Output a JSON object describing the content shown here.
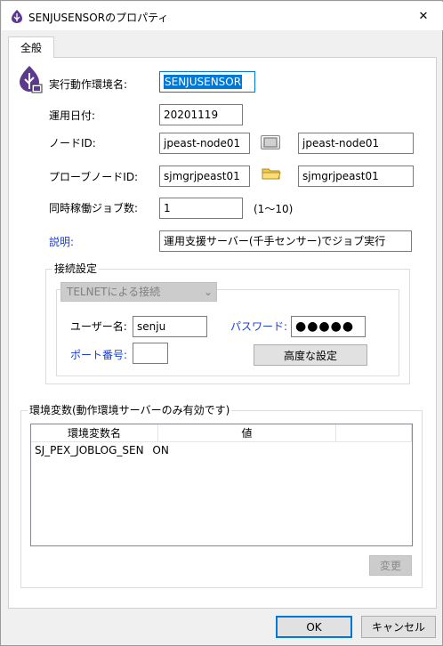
{
  "window": {
    "title": "SENJUSENSORのプロパティ",
    "close_glyph": "✕"
  },
  "tab": {
    "label": "全般"
  },
  "fields": {
    "env_name": {
      "label": "実行動作環境名:",
      "value": "SENJUSENSOR"
    },
    "operation_date": {
      "label": "運用日付:",
      "value": "20201119"
    },
    "node_id": {
      "label": "ノードID:",
      "value": "jpeast-node01",
      "display": "jpeast-node01"
    },
    "probe_node_id": {
      "label": "プローブノードID:",
      "value": "sjmgrjpeast01",
      "display": "sjmgrjpeast01"
    },
    "concurrent_jobs": {
      "label": "同時稼働ジョブ数:",
      "value": "1",
      "range": "(1〜10)"
    },
    "description": {
      "label": "説明:",
      "value": "運用支援サーバー(千手センサー)でジョブ実行"
    }
  },
  "connection": {
    "group_title": "接続設定",
    "method": "TELNETによる接続",
    "user_label": "ユーザー名:",
    "user_value": "senju",
    "password_label": "パスワード:",
    "password_value": "●●●●●",
    "port_label": "ポート番号:",
    "port_value": "",
    "advanced_button": "高度な設定"
  },
  "env_vars": {
    "group_title": "環境変数(動作環境サーバーのみ有効です)",
    "columns": [
      "環境変数名",
      "値"
    ],
    "rows": [
      {
        "name": "SJ_PEX_JOBLOG_SEN",
        "value": "ON"
      }
    ],
    "change_button": "変更"
  },
  "footer": {
    "ok": "OK",
    "cancel": "キャンセル"
  },
  "colors": {
    "accent": "#0078d7",
    "link_label": "#1a3fd0",
    "icon_purple": "#5b3a8e"
  }
}
